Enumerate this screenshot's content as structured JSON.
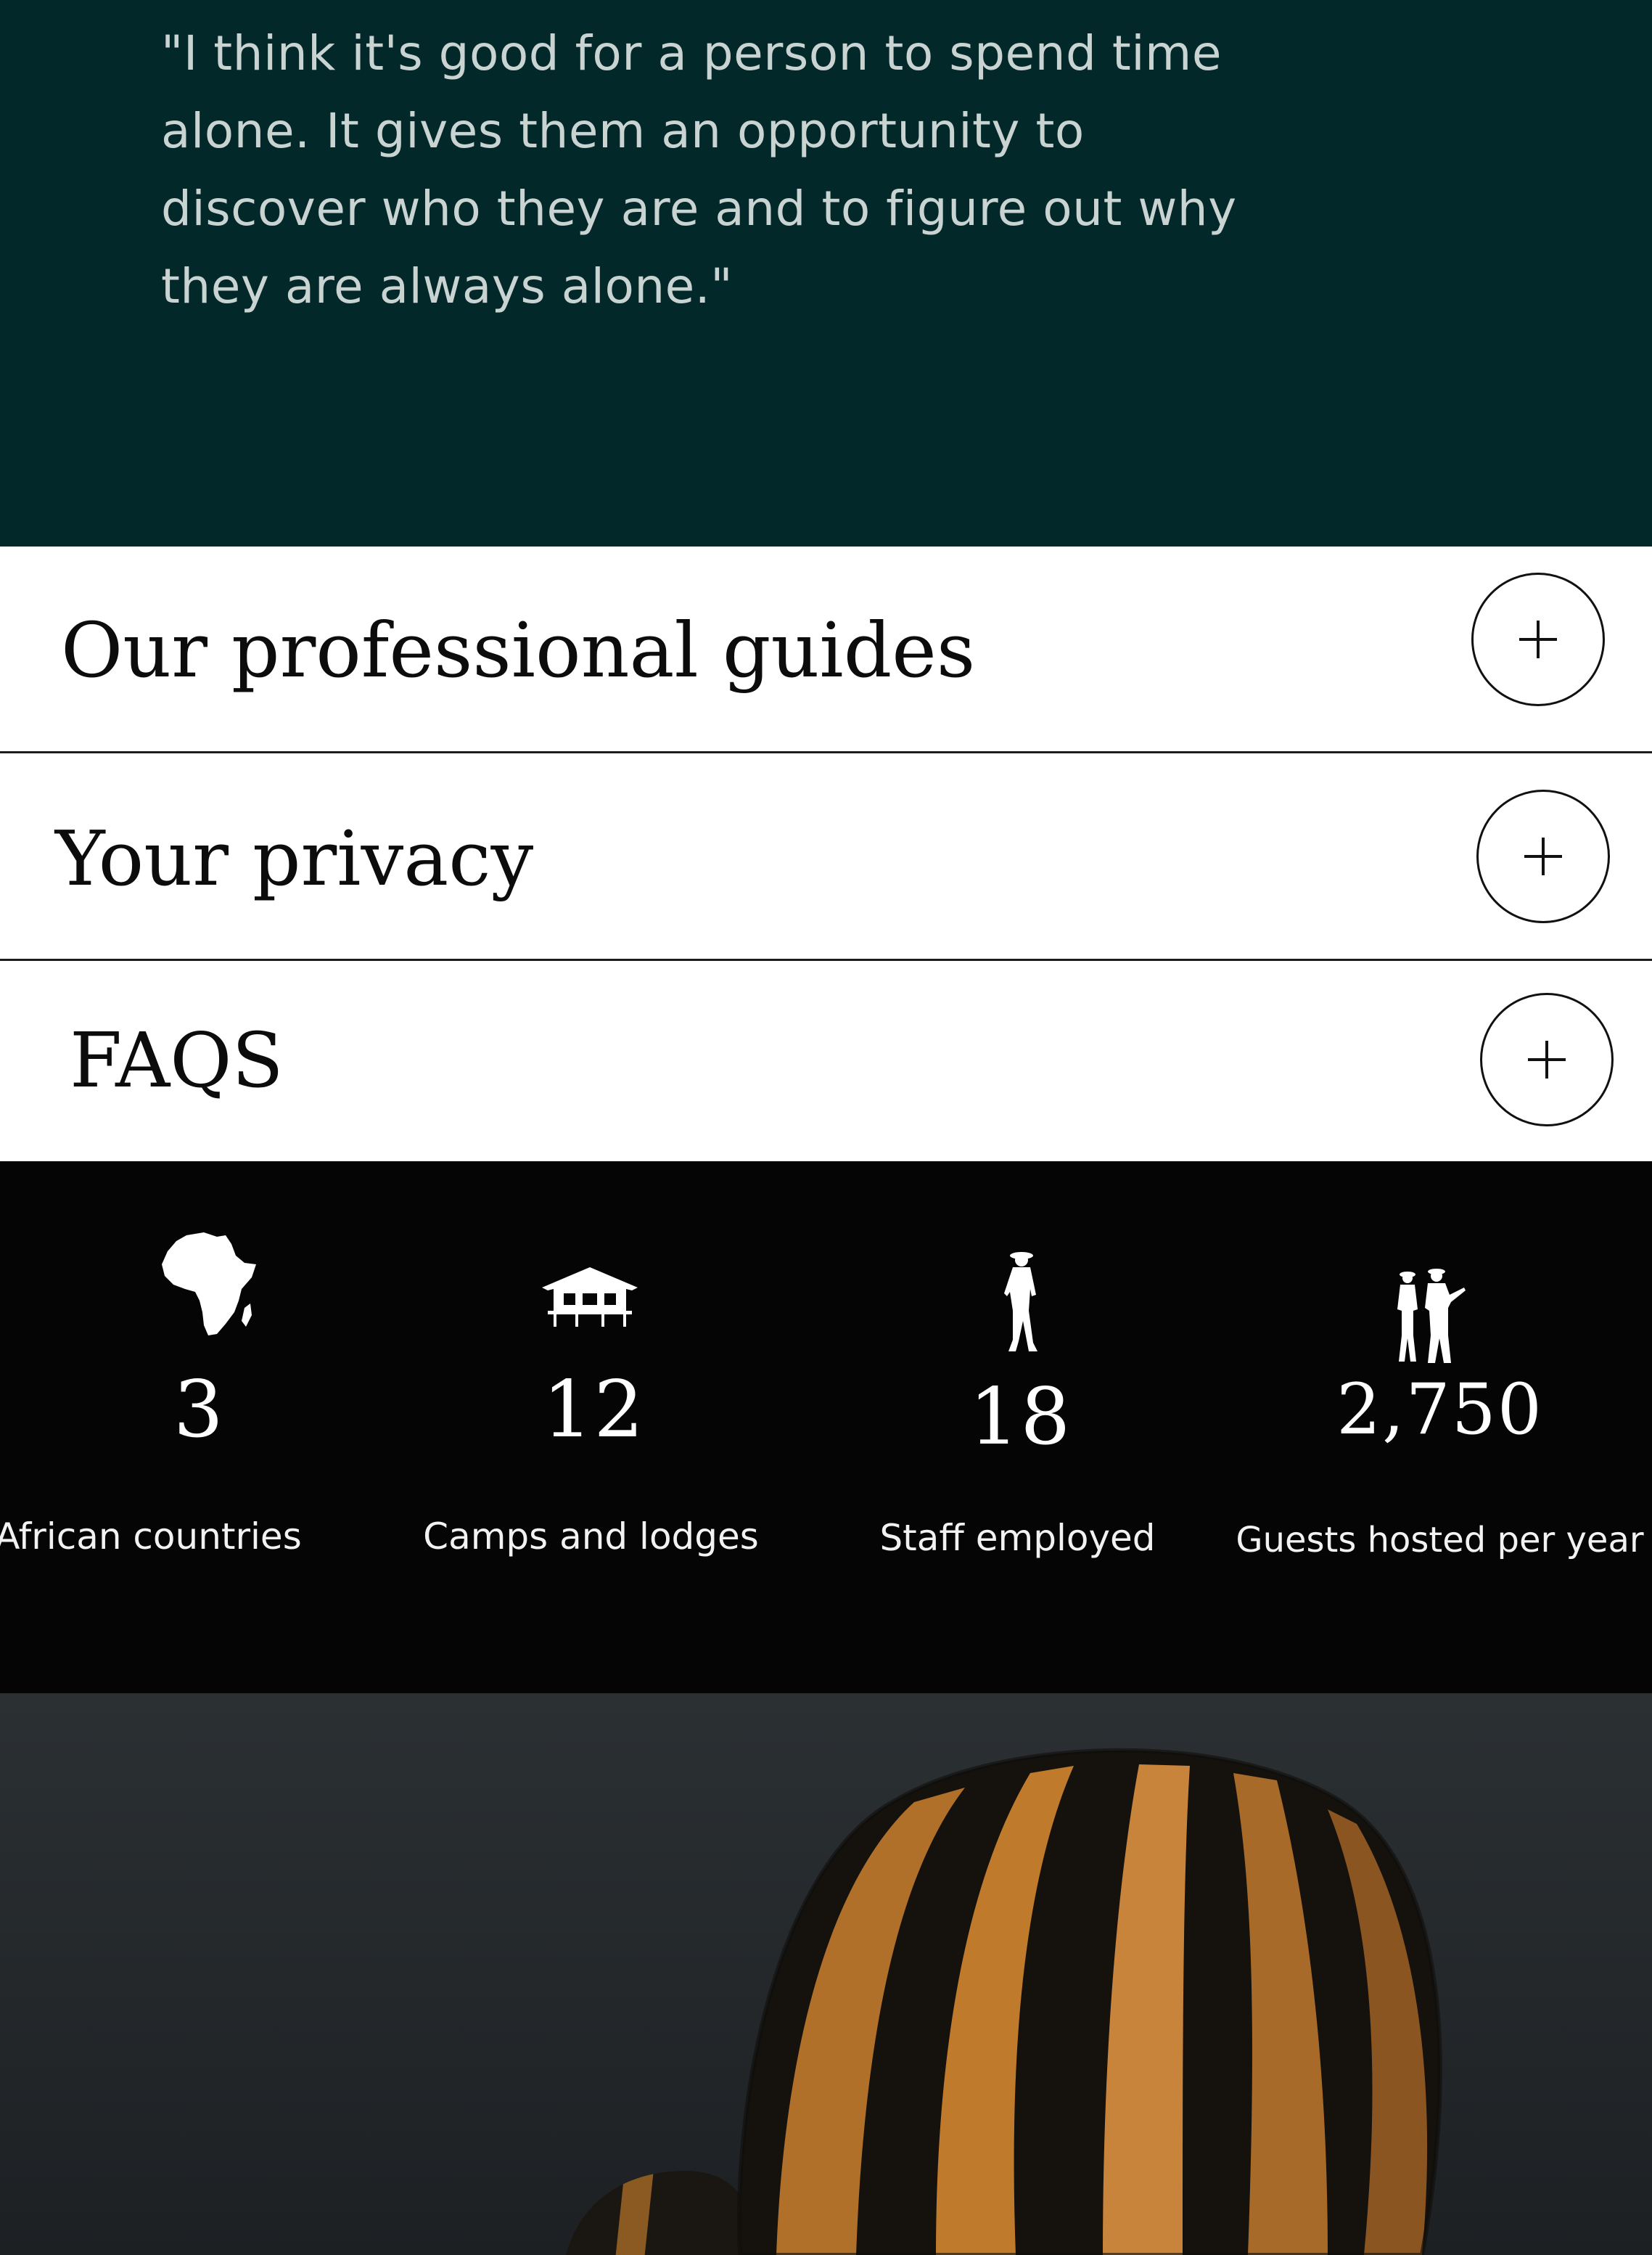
{
  "quote": {
    "text": "\"I think it's good for a person to spend time alone. It gives them an opportunity to discover who they are and to figure out why they are always alone.\""
  },
  "accordion": [
    {
      "title": "Our professional guides",
      "expanded": false
    },
    {
      "title": "Your privacy",
      "expanded": false
    },
    {
      "title": "FAQS",
      "expanded": false
    }
  ],
  "stats": [
    {
      "number": "3",
      "label": "African countries",
      "icon": "africa-map-icon"
    },
    {
      "number": "12",
      "label": "Camps and lodges",
      "icon": "tent-icon"
    },
    {
      "number": "18",
      "label": "Staff employed",
      "icon": "guide-person-icon"
    },
    {
      "number": "2,750",
      "label": "Guests hosted per year",
      "icon": "guests-group-icon"
    }
  ],
  "colors": {
    "quote_background": "#02282a",
    "quote_text": "#c9d3d1",
    "stats_background": "#050505",
    "balloon_orange": "#c07a2c",
    "balloon_dark": "#15120e"
  }
}
